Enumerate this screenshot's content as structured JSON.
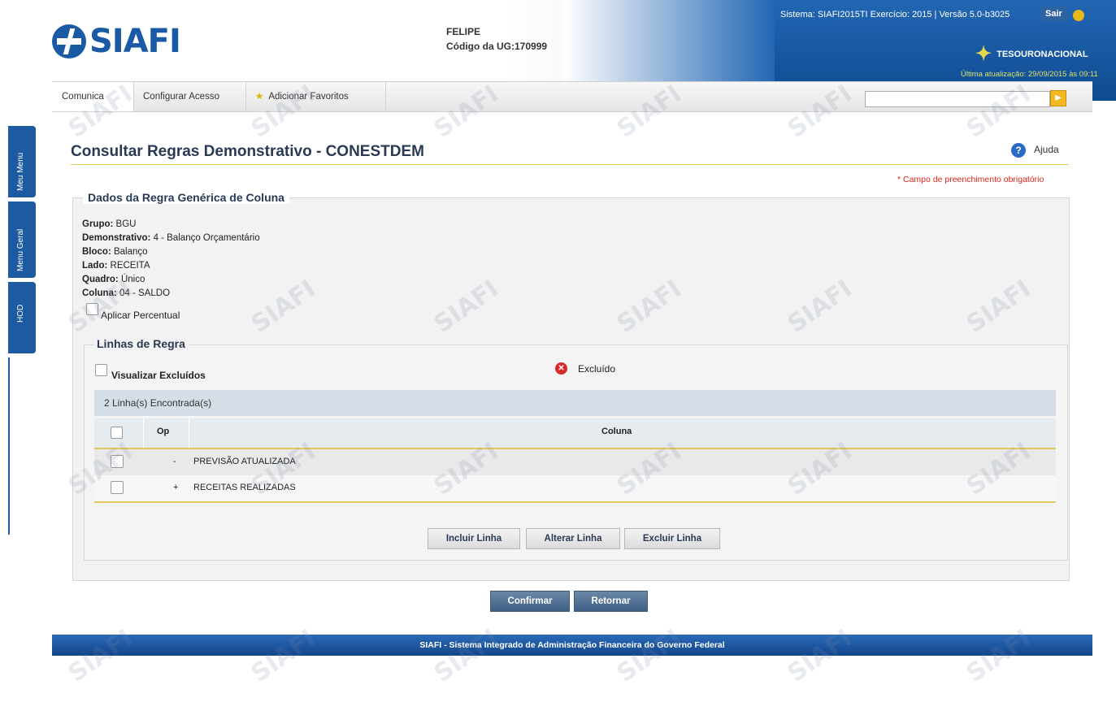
{
  "header": {
    "logo_text": "SIAFI",
    "user_name": "FELIPE",
    "ug_label": "Código da UG:",
    "ug_code": "170999",
    "system_info": "Sistema: SIAFI2015TI Exercício: 2015 | Versão 5.0-b3025",
    "exit_label": "Sair",
    "tesouro_label": "TESOURONACIONAL",
    "last_update": "Última atualização: 29/09/2015 às 09:11"
  },
  "menu": {
    "items": [
      "Comunica",
      "Configurar Acesso",
      "Adicionar Favoritos"
    ],
    "search_placeholder": ""
  },
  "sidetabs": [
    "Meu Menu",
    "Menu Geral",
    "HOD"
  ],
  "page": {
    "title": "Consultar Regras Demonstrativo - CONESTDEM",
    "help_label": "Ajuda",
    "required_note": "* Campo de preenchimento obrigatório"
  },
  "dados": {
    "legend": "Dados da Regra Genérica de Coluna",
    "fields": [
      {
        "label": "Grupo:",
        "value": "BGU"
      },
      {
        "label": "Demonstrativo:",
        "value": "4 - Balanço Orçamentário"
      },
      {
        "label": "Bloco:",
        "value": "Balanço"
      },
      {
        "label": "Lado:",
        "value": "RECEITA"
      },
      {
        "label": "Quadro:",
        "value": "Único"
      },
      {
        "label": "Coluna:",
        "value": "04 - SALDO"
      }
    ],
    "aplicar_percentual": "Aplicar Percentual"
  },
  "linhas": {
    "legend": "Linhas de Regra",
    "visualizar_excluidos": "Visualizar Excluídos",
    "excluido_legend": "Excluído",
    "count_text": "2 Linha(s) Encontrada(s)",
    "columns": {
      "op": "Op",
      "coluna": "Coluna"
    },
    "rows": [
      {
        "op": "-",
        "coluna": "PREVISÃO ATUALIZADA"
      },
      {
        "op": "+",
        "coluna": "RECEITAS REALIZADAS"
      }
    ],
    "buttons": {
      "incluir": "Incluir Linha",
      "alterar": "Alterar Linha",
      "excluir": "Excluir Linha"
    }
  },
  "actions": {
    "confirmar": "Confirmar",
    "retornar": "Retornar"
  },
  "footer": {
    "text": "SIAFI - Sistema Integrado de Administração Financeira do Governo Federal"
  },
  "watermark": "SIAFI"
}
